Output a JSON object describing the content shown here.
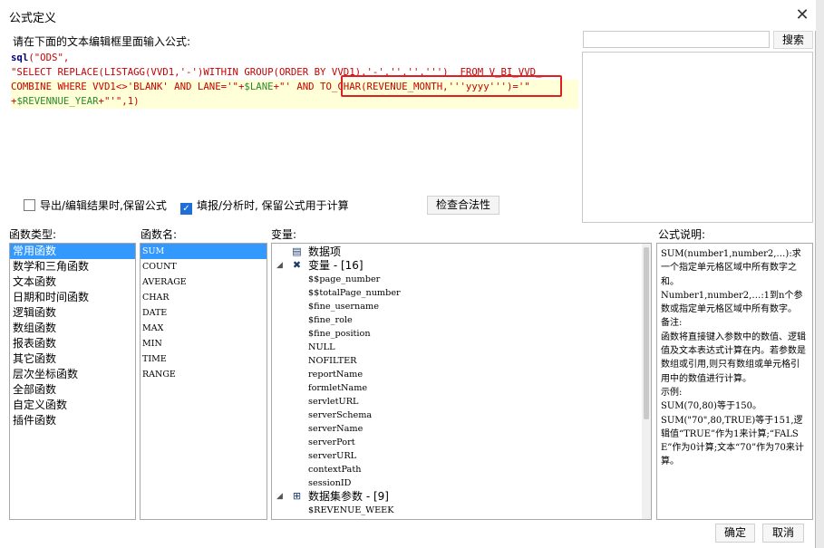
{
  "window": {
    "title": "公式定义",
    "close_glyph": "✕"
  },
  "editor": {
    "label": "请在下面的文本编辑框里面输入公式:",
    "lines": [
      [
        {
          "t": "sql",
          "c": "kw"
        },
        {
          "t": "(\"ODS\",",
          "c": "str"
        }
      ],
      [
        {
          "t": "\"SELECT REPLACE(LISTAGG(VVD1,'-')WITHIN GROUP(ORDER BY VVD1),'-','','',''')  FROM V_BI_VVD_",
          "c": "str"
        }
      ],
      [
        {
          "t": "COMBINE WHERE VVD1<>'BLANK' AND LANE='\"+",
          "c": "str"
        },
        {
          "t": "$LANE",
          "c": "var"
        },
        {
          "t": "+\"' AND TO_CHAR(REVENUE_MONTH,'''yyyy''')='\"",
          "c": "str"
        }
      ],
      [
        {
          "t": "+",
          "c": "str"
        },
        {
          "t": "$REVENNUE_YEAR",
          "c": "var"
        },
        {
          "t": "+\"'\",1)",
          "c": "str"
        }
      ]
    ]
  },
  "search": {
    "value": "",
    "button_label": "搜索"
  },
  "options": {
    "export_keep_formula": {
      "label": "导出/编辑结果时,保留公式",
      "checked": false
    },
    "fill_keep_formula": {
      "label": "填报/分析时, 保留公式用于计算",
      "checked": true
    },
    "check_mark": "✓",
    "validate_label": "检查合法性"
  },
  "categories": {
    "label": "函数类型:",
    "selected": 0,
    "items": [
      "常用函数",
      "数学和三角函数",
      "文本函数",
      "日期和时间函数",
      "逻辑函数",
      "数组函数",
      "报表函数",
      "其它函数",
      "层次坐标函数",
      "全部函数",
      "自定义函数",
      "插件函数"
    ]
  },
  "functions": {
    "label": "函数名:",
    "selected": 0,
    "items": [
      "SUM",
      "COUNT",
      "AVERAGE",
      "CHAR",
      "DATE",
      "MAX",
      "MIN",
      "TIME",
      "RANGE"
    ]
  },
  "variables": {
    "label": "变量:",
    "data_items_label": "数据项",
    "var_group_label": "变量 - [16]",
    "var_items": [
      "$$page_number",
      "$$totalPage_number",
      "$fine_username",
      "$fine_role",
      "$fine_position",
      "NULL",
      "NOFILTER",
      "reportName",
      "formletName",
      "servletURL",
      "serverSchema",
      "serverName",
      "serverPort",
      "serverURL",
      "contextPath",
      "sessionID"
    ],
    "dataset_group_label": "数据集参数 - [9]",
    "dataset_items": [
      "$REVENUE_WEEK"
    ],
    "icons": {
      "data_items": "table-icon",
      "var_group": "variable-icon",
      "dataset_group": "dataset-icon"
    },
    "glyph_collapse": "◢",
    "glyph_var": "✖",
    "glyph_table": "▤",
    "glyph_dataset": "⊞"
  },
  "description": {
    "label": "公式说明:",
    "paragraphs": [
      "SUM(number1,number2,…):求一个指定单元格区域中所有数字之和。",
      "Number1,number2,…:1到n个参数或指定单元格区域中所有数字。",
      "备注:",
      "函数将直接键入参数中的数值、逻辑值及文本表达式计算在内。若参数是数组或引用,则只有数组或单元格引用中的数值进行计算。",
      "示例:",
      "SUM(70,80)等于150。",
      "SUM(\"70\",80,TRUE)等于151,逻辑值“TRUE”作为1来计算;“FALSE”作为0计算;文本“70”作为70来计算。"
    ]
  },
  "footer": {
    "ok_label": "确定",
    "cancel_label": "取消"
  }
}
